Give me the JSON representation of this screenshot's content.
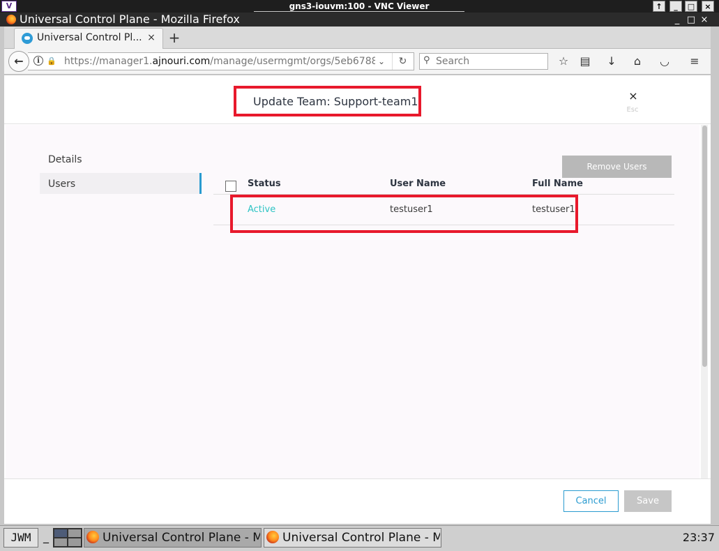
{
  "vnc": {
    "logo": "V",
    "title": "gns3-iouvm:100 - VNC Viewer",
    "buttons": [
      "↑",
      "_",
      "□",
      "×"
    ]
  },
  "window": {
    "title": "Universal Control Plane - Mozilla Firefox",
    "buttons": [
      "_",
      "□",
      "×"
    ]
  },
  "tab": {
    "label": "Universal Control Pl...",
    "close": "×",
    "new_tab": "+"
  },
  "navbar": {
    "url_prefix": "https://manager1.",
    "url_domain": "ajnouri.com",
    "url_path": "/manage/usermgmt/orgs/5eb6788",
    "search_placeholder": "Search"
  },
  "modal": {
    "title": "Update Team: Support-team1",
    "close": "×",
    "close_hint": "Esc",
    "nav": {
      "details": "Details",
      "users": "Users"
    },
    "remove_button": "Remove Users",
    "table": {
      "headers": {
        "status": "Status",
        "user_name": "User Name",
        "full_name": "Full Name"
      },
      "rows": [
        {
          "status": "Active",
          "user_name": "testuser1",
          "full_name": "testuser1"
        }
      ]
    },
    "cancel_button": "Cancel",
    "save_button": "Save"
  },
  "taskbar": {
    "start": "JWM",
    "minimize_all": "_",
    "tasks": [
      "Universal Control Plane - M",
      "Universal Control Plane - M"
    ],
    "clock": "23:37"
  },
  "colors": {
    "accent": "#2a9bd0",
    "status_active": "#2ec4c4",
    "highlight": "#e8192c",
    "disabled_button": "#b8b8b8"
  }
}
